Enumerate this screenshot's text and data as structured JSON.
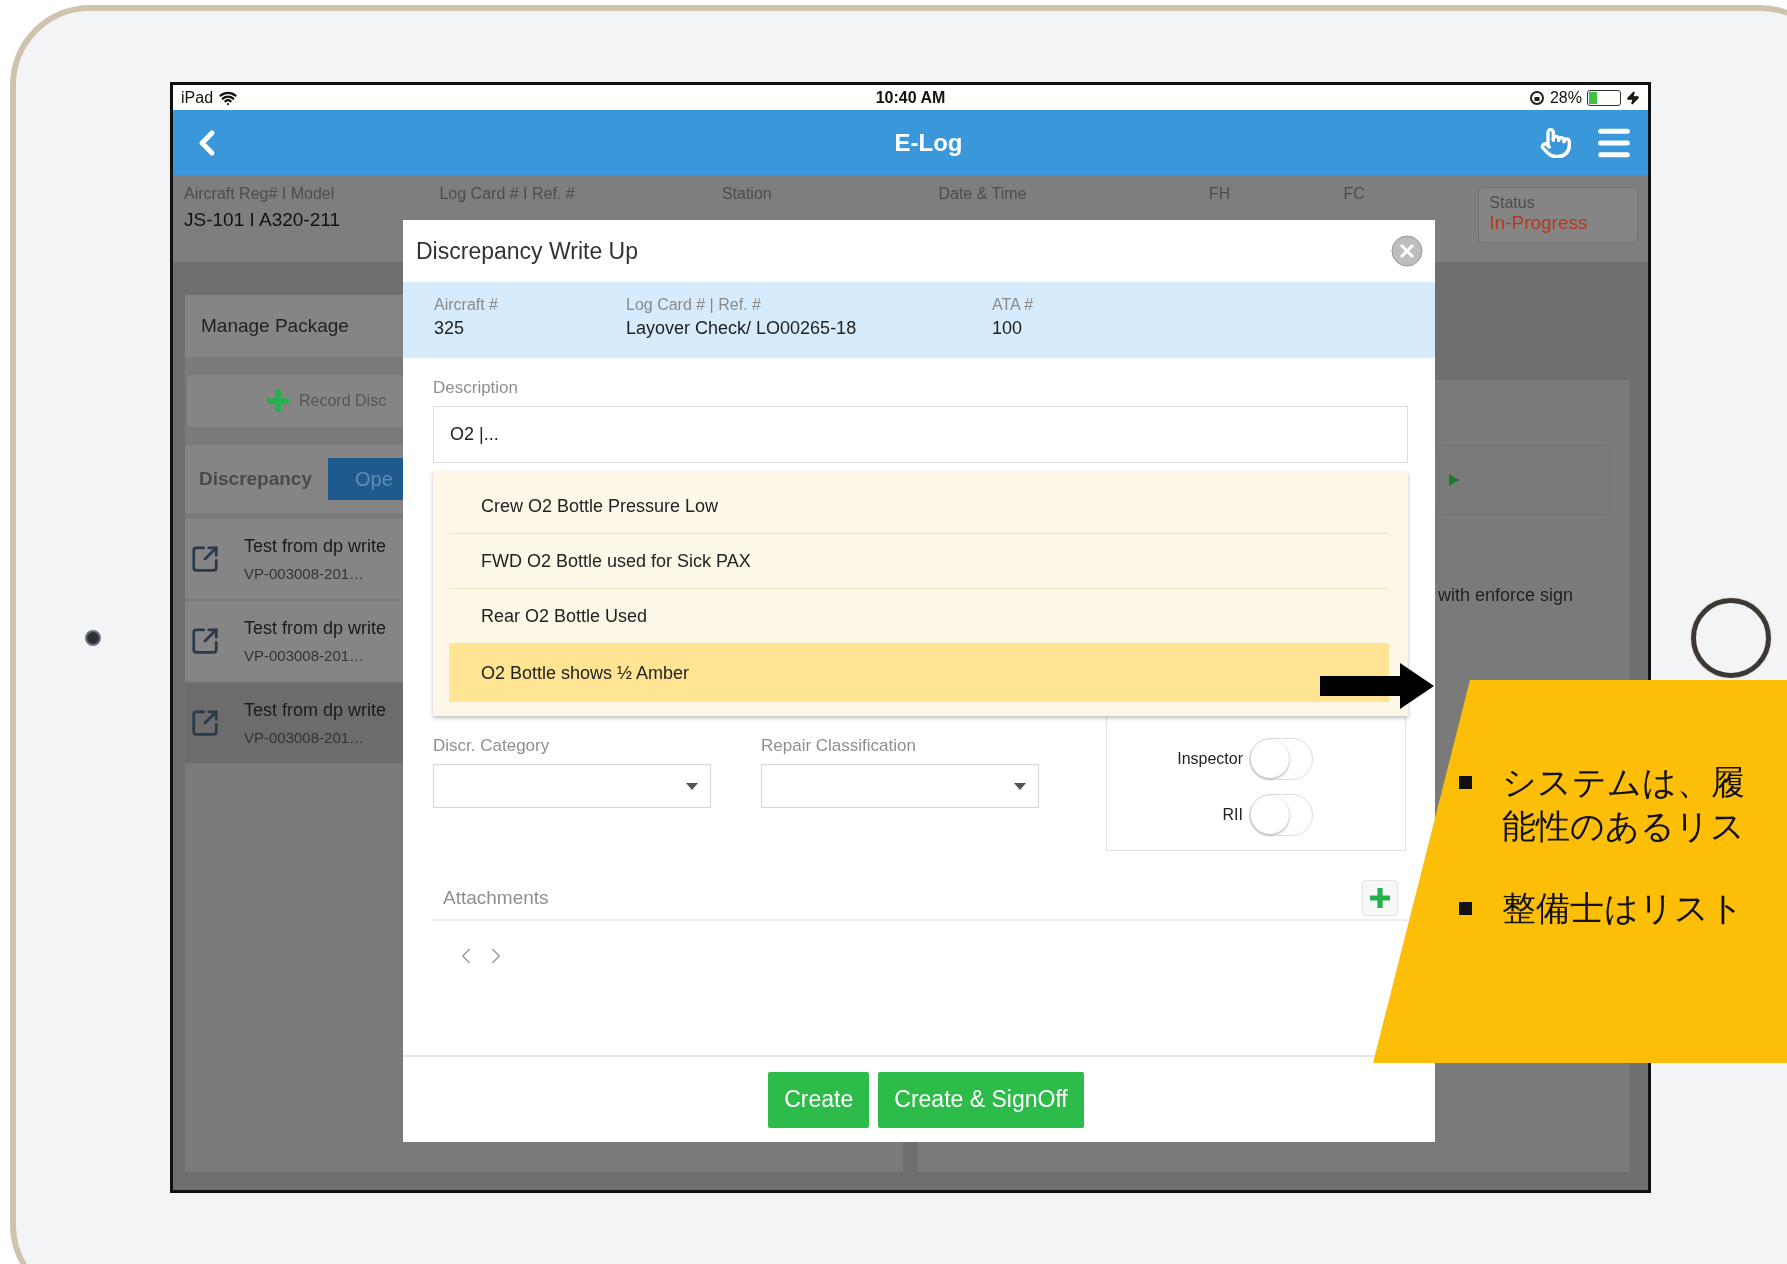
{
  "status_bar": {
    "device": "iPad",
    "time": "10:40 AM",
    "battery": "28%"
  },
  "header": {
    "title": "E-Log"
  },
  "summary": {
    "fields": [
      {
        "label": "Aircraft Reg# I Model",
        "value": "JS-101 I A320-211"
      },
      {
        "label": "Log Card # I Ref. #"
      },
      {
        "label": "Station"
      },
      {
        "label": "Date & Time"
      },
      {
        "label": "FH"
      },
      {
        "label": "FC"
      }
    ],
    "status": {
      "label": "Status",
      "value": "In-Progress"
    }
  },
  "side_panel": {
    "title": "Manage Package",
    "record_button": "Record Disc",
    "section_label": "Discrepancy",
    "tabs": [
      {
        "label": "Ope",
        "selected": true
      }
    ],
    "items": [
      {
        "title": "Test from dp write",
        "subtitle": "VP-003008-201…",
        "selected": false
      },
      {
        "title": "Test from dp write",
        "subtitle": "VP-003008-201…",
        "selected": false
      },
      {
        "title": "Test from dp write",
        "subtitle": "VP-003008-201…",
        "selected": true
      }
    ]
  },
  "detail_panel": {
    "text": "with enforce sign"
  },
  "dialog": {
    "title": "Discrepancy Write Up",
    "info": [
      {
        "label": "Aircraft #",
        "value": "325"
      },
      {
        "label": "Log Card # | Ref. #",
        "value": "Layover Check/ LO00265-18"
      },
      {
        "label": "ATA #",
        "value": "100"
      }
    ],
    "description": {
      "label": "Description",
      "value": "O2 |..."
    },
    "suggestions": [
      {
        "text": "Crew O2 Bottle Pressure Low",
        "selected": false
      },
      {
        "text": "FWD O2 Bottle used for Sick PAX",
        "selected": false
      },
      {
        "text": "Rear O2 Bottle Used",
        "selected": false
      },
      {
        "text": "O2 Bottle shows ½ Amber",
        "selected": true
      }
    ],
    "selects": [
      {
        "label": "Discr. Category"
      },
      {
        "label": "Repair Classification"
      }
    ],
    "toggles": [
      {
        "label": "Inspector",
        "on": false
      },
      {
        "label": "RII",
        "on": false
      }
    ],
    "attachments": {
      "label": "Attachments"
    },
    "buttons": [
      "Create",
      "Create & SignOff"
    ]
  },
  "callout": {
    "bullets": [
      {
        "lines": [
          "システムは、履",
          "能性のあるリス"
        ]
      },
      {
        "lines": [
          "整備士はリスト"
        ]
      }
    ]
  }
}
